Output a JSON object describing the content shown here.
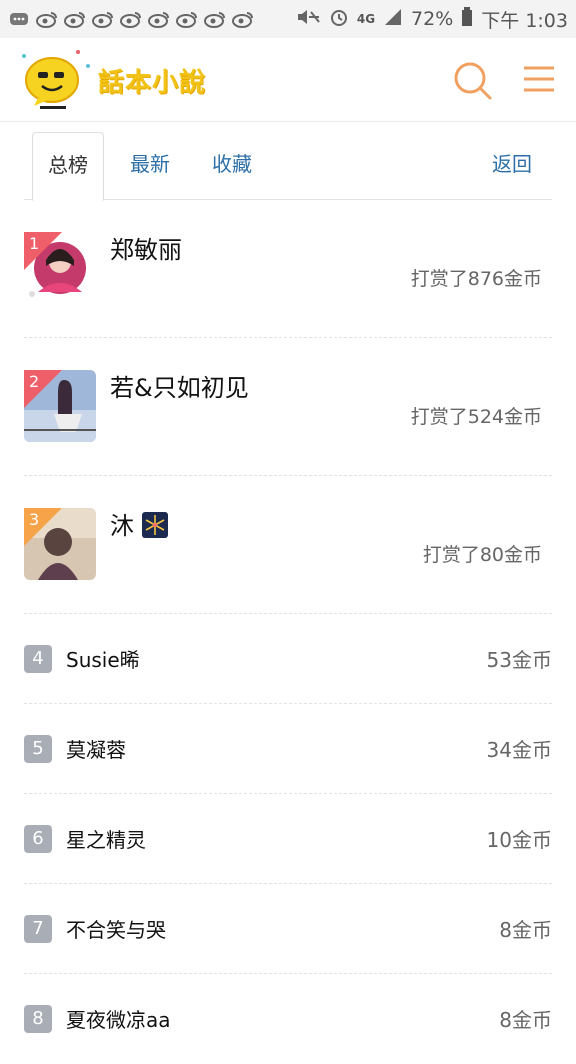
{
  "status_bar": {
    "network": "4G",
    "battery": "72%",
    "time": "下午 1:03"
  },
  "app": {
    "logo_text": "話本小說",
    "icons": [
      "search-icon",
      "menu-icon"
    ]
  },
  "tabs": [
    {
      "label": "总榜",
      "active": true
    },
    {
      "label": "最新",
      "active": false
    },
    {
      "label": "收藏",
      "active": false
    },
    {
      "label": "返回",
      "active": false
    }
  ],
  "top_ranks": [
    {
      "rank": "1",
      "name": "郑敏丽",
      "reward": "打赏了876金币",
      "flag_color": "#ef5f6a"
    },
    {
      "rank": "2",
      "name": "若&只如初见",
      "reward": "打赏了524金币",
      "flag_color": "#ef5f6a"
    },
    {
      "rank": "3",
      "name": "沐",
      "reward": "打赏了80金币",
      "flag_color": "#f6a34a"
    }
  ],
  "ranks": [
    {
      "rank": "4",
      "name": "Susie晞",
      "coins": "53金币"
    },
    {
      "rank": "5",
      "name": "莫凝蓉",
      "coins": "34金币"
    },
    {
      "rank": "6",
      "name": "星之精灵",
      "coins": "10金币"
    },
    {
      "rank": "7",
      "name": "不合笑与哭",
      "coins": "8金币"
    },
    {
      "rank": "8",
      "name": "夏夜微凉aa",
      "coins": "8金币"
    }
  ],
  "colors": {
    "accent_orange": "#f0a060",
    "tab_link_blue": "#2d6fa7",
    "rank_gray": "#a9aeb6"
  }
}
